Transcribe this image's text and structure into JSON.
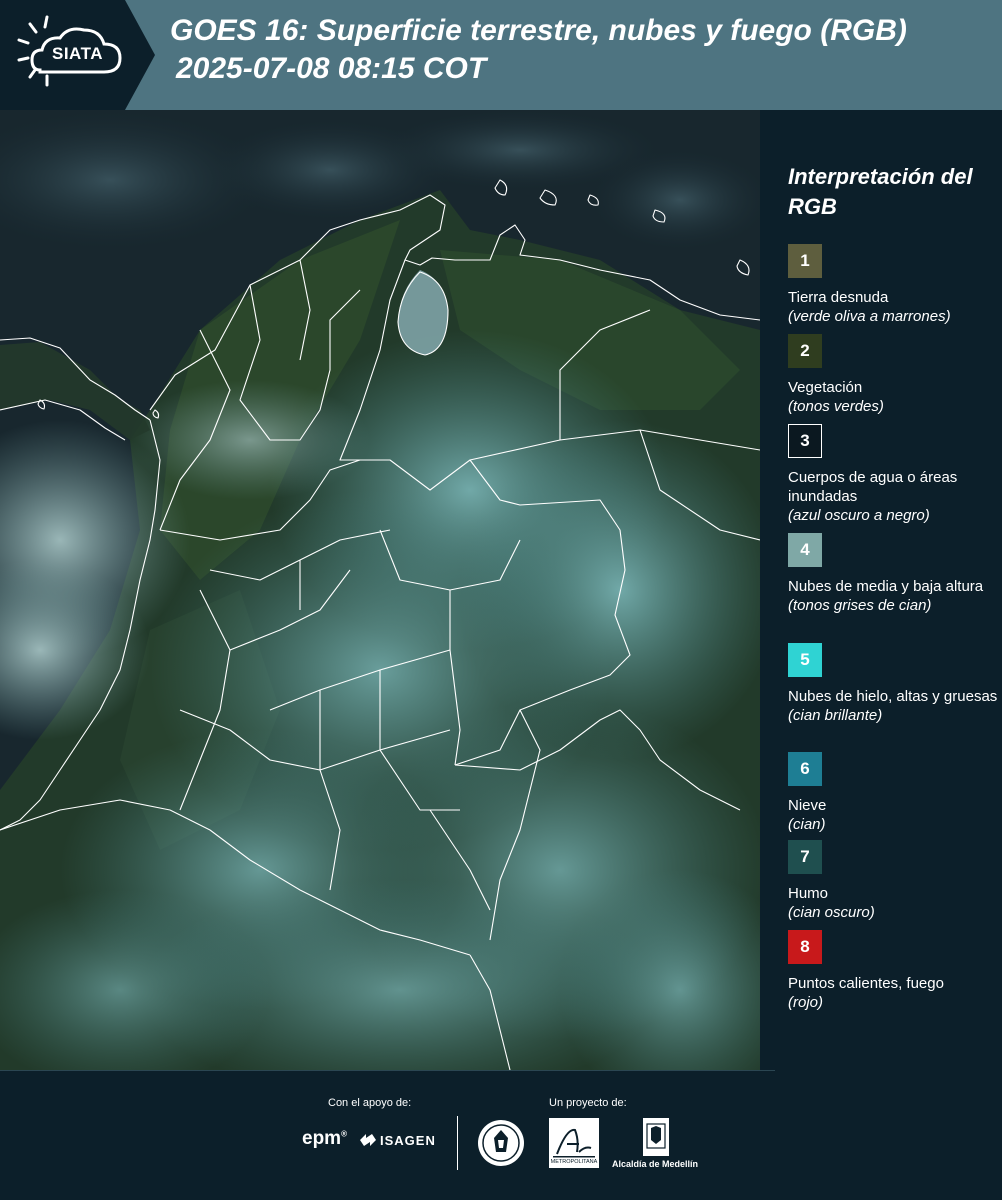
{
  "header": {
    "logo_text": "SIATA",
    "title_line1": "GOES 16: Superficie terrestre, nubes y fuego (RGB)",
    "title_line2": "2025-07-08 08:15 COT"
  },
  "legend": {
    "title": "Interpretación del RGB",
    "items": [
      {
        "number": "1",
        "color": "#5e5e3e",
        "label": "Tierra desnuda",
        "note": "(verde oliva a marrones)"
      },
      {
        "number": "2",
        "color": "#2f3d1f",
        "label": "Vegetación",
        "note": "(tonos verdes)"
      },
      {
        "number": "3",
        "color": "#0b1820",
        "label": "Cuerpos de agua o áreas inundadas",
        "note": "(azul oscuro a negro)"
      },
      {
        "number": "4",
        "color": "#7fa8a6",
        "label": "Nubes de media y baja altura",
        "note": "(tonos grises de cian)"
      },
      {
        "number": "5",
        "color": "#2fd3d3",
        "label": "Nubes de hielo, altas y gruesas",
        "note": "(cian brillante)"
      },
      {
        "number": "6",
        "color": "#1e7e94",
        "label": "Nieve",
        "note": "(cian)"
      },
      {
        "number": "7",
        "color": "#1f4f4f",
        "label": "Humo",
        "note": "(cian oscuro)"
      },
      {
        "number": "8",
        "color": "#c8191b",
        "label": "Puntos calientes, fuego",
        "note": "(rojo)"
      }
    ]
  },
  "footer": {
    "support_label": "Con el apoyo de:",
    "project_label": "Un proyecto de:",
    "sponsor_epm": "epm",
    "sponsor_isagen": "ISAGEN",
    "amva_text": "METROPOLITANA",
    "alcaldia_text": "Alcaldía de Medellín"
  },
  "colors": {
    "header_bg": "#4e7481",
    "panel_bg": "#0c1f2a",
    "border_lines": "#ffffff"
  }
}
